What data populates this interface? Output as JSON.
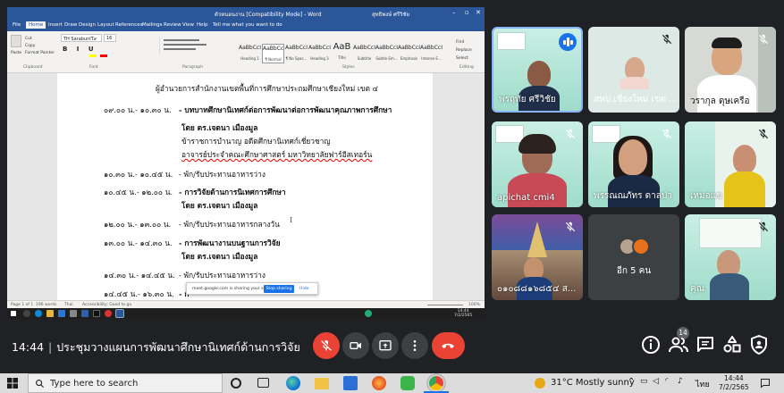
{
  "word": {
    "title": "ตัวหนอนงาน [Compatibility Mode] - Word",
    "user": "สุทธิพงษ์ ศรีวิชัย",
    "tabs": [
      "File",
      "Home",
      "Insert",
      "Draw",
      "Design",
      "Layout",
      "References",
      "Mailings",
      "Review",
      "View",
      "Help",
      "Tell me what you want to do"
    ],
    "active_tab": "Home",
    "clipboard": {
      "paste": "Paste",
      "cut": "Cut",
      "copy": "Copy",
      "format_painter": "Format Painter",
      "label": "Clipboard"
    },
    "font_name": "TH SarabunIT๙",
    "font_size": "16",
    "font_label": "Font",
    "paragraph_label": "Paragraph",
    "styles": [
      {
        "preview": "AaBbCcI",
        "name": "Heading 1"
      },
      {
        "preview": "AaBbCcI",
        "name": "¶ Normal"
      },
      {
        "preview": "AaBbCcI",
        "name": "¶ No Spac..."
      },
      {
        "preview": "AaBbCcI",
        "name": "Heading 3"
      },
      {
        "preview": "AaB",
        "name": "Title"
      },
      {
        "preview": "AaBbCcI",
        "name": "Subtitle"
      },
      {
        "preview": "AaBbCcI",
        "name": "Subtle Em..."
      },
      {
        "preview": "AaBbCcI",
        "name": "Emphasis"
      },
      {
        "preview": "AaBbCcI",
        "name": "Intense E..."
      }
    ],
    "styles_label": "Styles",
    "editing": {
      "find": "Find",
      "replace": "Replace",
      "select": "Select",
      "label": "Editing"
    },
    "doc_lines": [
      {
        "text": "ผู้อำนวยการสำนักงานเขตพื้นที่การศึกษาประถมศึกษาเชียงใหม่ เขต ๔",
        "bold": false
      },
      {
        "time": "๐๙.๐๐ น.- ๑๐.๓๐ น.",
        "text": "- บทบาทศึกษานิเทศก์ต่อการพัฒนาต่อการพัฒนาคุณภาพการศึกษา",
        "bold": true
      },
      {
        "text": "โดย ดร.เจตนา  เมืองมูล",
        "bold": true
      },
      {
        "text": "ข้าราชการบำนาญ อดีตศึกษานิเทศก์เชี่ยวชาญ",
        "bold": false
      },
      {
        "text": "อาจารย์ประจำคณะศึกษาศาสตร์ มหาวิทยาลัยฟาร์อีสเทอร์น",
        "bold": false
      },
      {
        "time": "๑๐.๓๐ น.- ๑๐.๔๕ น.",
        "text": "- พัก/รับประทานอาหารว่าง",
        "bold": false
      },
      {
        "time": "๑๐.๔๕ น.- ๑๒.๐๐ น.",
        "text": "- การวิจัยด้านการนิเทศการศึกษา",
        "bold": true
      },
      {
        "text": "โดย ดร.เจตนา  เมืองมูล",
        "bold": true
      },
      {
        "time": "๑๒.๐๐ น.- ๑๓.๐๐ น.",
        "text": "- พัก/รับประทานอาหารกลางวัน",
        "bold": false
      },
      {
        "time": "๑๓.๐๐ น.- ๑๔.๓๐ น.",
        "text": "- การพัฒนางานบนฐานการวิจัย",
        "bold": true
      },
      {
        "text": "โดย ดร.เจตนา  เมืองมูล",
        "bold": true
      },
      {
        "time": "๑๔.๓๐ น.- ๑๔.๔๕ น.",
        "text": "- พัก/รับประทานอาหารว่าง",
        "bold": false
      },
      {
        "time": "๑๔.๔๕ น.- ๑๖.๓๐ น.",
        "text": "- ก",
        "bold": true
      }
    ],
    "status": {
      "page": "Page 1 of 1",
      "words": "196 words",
      "lang": "Thai",
      "accessibility": "Accessibility: Good to go",
      "zoom": "100%"
    },
    "share_bar": {
      "message": "meet.google.com is sharing your screen.",
      "stop": "Stop sharing",
      "hide": "Hide"
    },
    "inner_clock": {
      "time": "14:44",
      "date": "7/2/2565"
    }
  },
  "participants": [
    {
      "name": "พรฤทัย ศรีวิชัย",
      "state": "speaking"
    },
    {
      "name": "",
      "state": "muted"
    },
    {
      "name": "วรากุล ดุษเครือ",
      "state": "muted"
    },
    {
      "name": "สพป.เชียงใหม่ เขต ...",
      "state": "muted"
    },
    {
      "name": "apichat cmi4",
      "state": "muted"
    },
    {
      "name": "พรรณณภัทร ดาลป่า",
      "state": "muted"
    },
    {
      "name": "เหมอแข",
      "state": "muted"
    },
    {
      "name": "๐๑๐๘๘๑๖๘๕๔ ส...",
      "state": "muted"
    },
    {
      "name": "อีก 5 คน",
      "state": "others"
    },
    {
      "name": "คุณ",
      "state": "muted"
    }
  ],
  "meet": {
    "time": "14:44",
    "meeting_title": "ประชุมวางแผนการพัฒนาศึกษานิเทศก์ด้านการวิจัย",
    "people_count": "14",
    "colors": {
      "end_call": "#ea4335",
      "speaking": "#1a73e8"
    }
  },
  "windows": {
    "search_placeholder": "Type here to search",
    "weather": "31°C  Mostly sunny",
    "lang": "ไทย",
    "time": "14:44",
    "date": "7/2/2565"
  }
}
